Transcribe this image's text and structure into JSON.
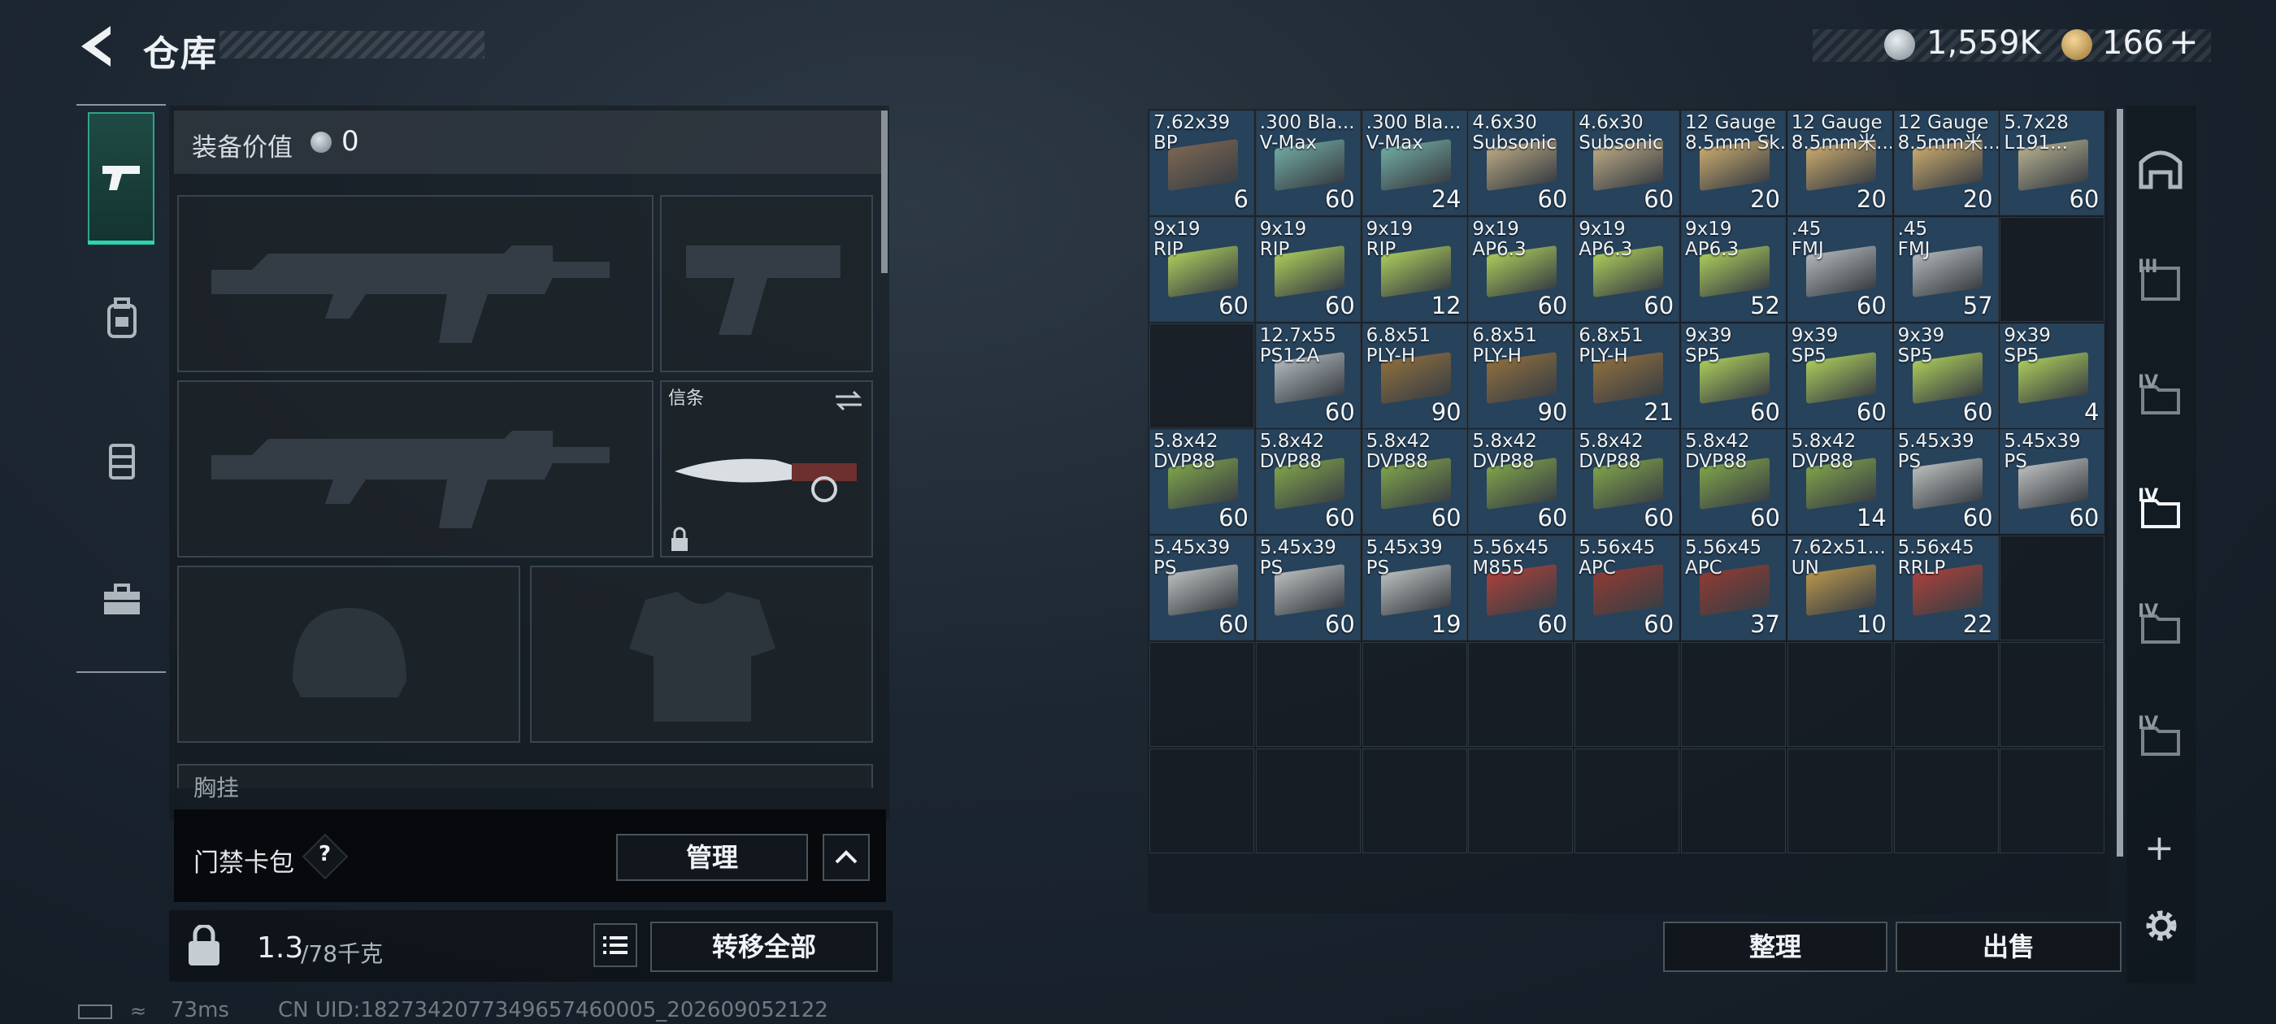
{
  "header": {
    "title": "仓库"
  },
  "currency": {
    "silver": "1,559K",
    "gold": "166",
    "gold_plus": "+"
  },
  "equipment": {
    "value_label": "装备价值",
    "value": "0",
    "secure_label": "信条",
    "chest_label": "胸挂"
  },
  "card_pack": {
    "label": "门禁卡包",
    "help": "?",
    "manage_label": "管理"
  },
  "weight": {
    "current": "1.3",
    "max": "/78千克"
  },
  "transfer_all_label": "转移全部",
  "stash": {
    "sort_label": "整理",
    "sell_label": "出售",
    "items": [
      {
        "name": "7.62x39\nBP",
        "qty": "6",
        "color": "#7b6552"
      },
      {
        "name": ".300 Bla...\nV-Max",
        "qty": "60",
        "color": "#6fa8a0"
      },
      {
        "name": ".300 Bla...\nV-Max",
        "qty": "24",
        "color": "#6fa8a0"
      },
      {
        "name": "4.6x30\nSubsonic",
        "qty": "60",
        "color": "#b8a783"
      },
      {
        "name": "4.6x30\nSubsonic",
        "qty": "60",
        "color": "#b8a783"
      },
      {
        "name": "12 Gauge\n8.5mm Sk...",
        "qty": "20",
        "color": "#c7a86c"
      },
      {
        "name": "12 Gauge\n8.5mm米...",
        "qty": "20",
        "color": "#c7a86c"
      },
      {
        "name": "12 Gauge\n8.5mm米...",
        "qty": "20",
        "color": "#c7a86c"
      },
      {
        "name": "5.7x28\nL191...",
        "qty": "60",
        "color": "#b2ad8e"
      },
      {
        "name": "9x19\nRIP",
        "qty": "60",
        "color": "#a9c95a"
      },
      {
        "name": "9x19\nRIP",
        "qty": "60",
        "color": "#a9c95a"
      },
      {
        "name": "9x19\nRIP",
        "qty": "12",
        "color": "#a9c95a"
      },
      {
        "name": "9x19\nAP6.3",
        "qty": "60",
        "color": "#a9c95a"
      },
      {
        "name": "9x19\nAP6.3",
        "qty": "60",
        "color": "#a9c95a"
      },
      {
        "name": "9x19\nAP6.3",
        "qty": "52",
        "color": "#a9c95a"
      },
      {
        "name": ".45\nFMJ",
        "qty": "60",
        "color": "#aeb4b8"
      },
      {
        "name": ".45\nFMJ",
        "qty": "57",
        "color": "#aeb4b8"
      },
      null,
      null,
      {
        "name": "12.7x55\nPS12A",
        "qty": "60",
        "color": "#aeb6bb"
      },
      {
        "name": "6.8x51\nPLY-H",
        "qty": "90",
        "color": "#8d6e3e"
      },
      {
        "name": "6.8x51\nPLY-H",
        "qty": "90",
        "color": "#8d6e3e"
      },
      {
        "name": "6.8x51\nPLY-H",
        "qty": "21",
        "color": "#8d6e3e"
      },
      {
        "name": "9x39\nSP5",
        "qty": "60",
        "color": "#a9c95a"
      },
      {
        "name": "9x39\nSP5",
        "qty": "60",
        "color": "#a9c95a"
      },
      {
        "name": "9x39\nSP5",
        "qty": "60",
        "color": "#a9c95a"
      },
      {
        "name": "9x39\nSP5",
        "qty": "4",
        "color": "#a9c95a"
      },
      {
        "name": "5.8x42\nDVP88",
        "qty": "60",
        "color": "#7ea24a"
      },
      {
        "name": "5.8x42\nDVP88",
        "qty": "60",
        "color": "#7ea24a"
      },
      {
        "name": "5.8x42\nDVP88",
        "qty": "60",
        "color": "#7ea24a"
      },
      {
        "name": "5.8x42\nDVP88",
        "qty": "60",
        "color": "#7ea24a"
      },
      {
        "name": "5.8x42\nDVP88",
        "qty": "60",
        "color": "#7ea24a"
      },
      {
        "name": "5.8x42\nDVP88",
        "qty": "60",
        "color": "#7ea24a"
      },
      {
        "name": "5.8x42\nDVP88",
        "qty": "14",
        "color": "#7ea24a"
      },
      {
        "name": "5.45x39\nPS",
        "qty": "60",
        "color": "#b9bcbc"
      },
      {
        "name": "5.45x39\nPS",
        "qty": "60",
        "color": "#b9bcbc"
      },
      {
        "name": "5.45x39\nPS",
        "qty": "60",
        "color": "#b9bcbc"
      },
      {
        "name": "5.45x39\nPS",
        "qty": "60",
        "color": "#b9bcbc"
      },
      {
        "name": "5.45x39\nPS",
        "qty": "19",
        "color": "#b9bcbc"
      },
      {
        "name": "5.56x45\nM855",
        "qty": "60",
        "color": "#a8403b"
      },
      {
        "name": "5.56x45\nAPC",
        "qty": "60",
        "color": "#8e3a33"
      },
      {
        "name": "5.56x45\nAPC",
        "qty": "37",
        "color": "#8e3a33"
      },
      {
        "name": "7.62x51...\nUN",
        "qty": "10",
        "color": "#b5944c"
      },
      {
        "name": "5.56x45\nRRLP",
        "qty": "22",
        "color": "#a8403b"
      }
    ]
  },
  "right_tabs": {
    "labels": [
      "III",
      "IV",
      "IV",
      "IV",
      "IV"
    ],
    "add": "+"
  },
  "footer": {
    "ping": "73ms",
    "uid": "CN UID:1827342077349657460005_202609052122"
  }
}
